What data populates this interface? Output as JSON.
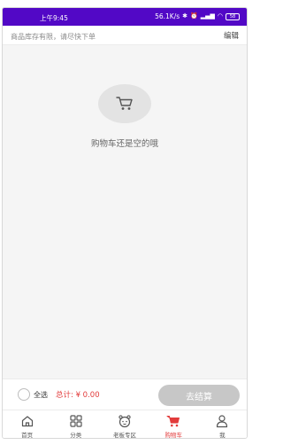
{
  "status_bar": {
    "time": "上午9:45",
    "speed": "56.1K/s",
    "battery": "58"
  },
  "notice": {
    "text": "商品库存有限，请尽快下单",
    "edit_label": "编辑"
  },
  "empty_state": {
    "icon": "cart-icon",
    "text": "购物车还是空的哦"
  },
  "checkout": {
    "select_all_label": "全选",
    "total_label": "总计: ¥ 0.00",
    "checkout_button_label": "去结算"
  },
  "tab_bar": {
    "active_color": "#e23b3b",
    "tabs": [
      {
        "label": "首页",
        "icon": "home-icon"
      },
      {
        "label": "分类",
        "icon": "category-grid-icon"
      },
      {
        "label": "老板专区",
        "icon": "boss-zone-icon"
      },
      {
        "label": "购物车",
        "icon": "cart-icon",
        "active": true
      },
      {
        "label": "我",
        "icon": "user-icon"
      }
    ]
  },
  "colors": {
    "status_bar": "#5208c6",
    "price_red": "#e23b3b",
    "checkout_button": "#c7c7c7"
  }
}
